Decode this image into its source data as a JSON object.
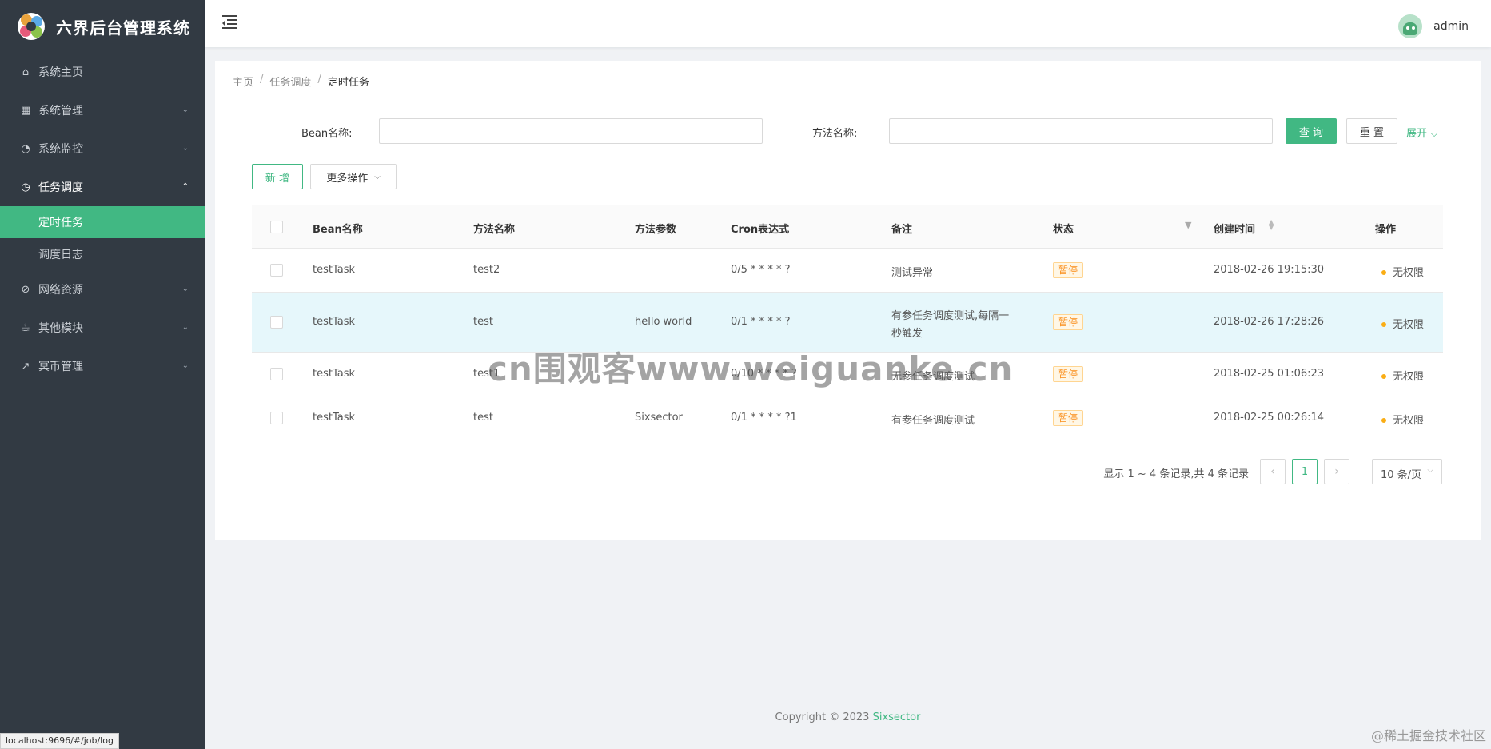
{
  "app": {
    "title": "六界后台管理系统"
  },
  "sidebar": {
    "items": [
      {
        "label": "系统主页",
        "icon": "home-icon"
      },
      {
        "label": "系统管理",
        "icon": "grid-icon"
      },
      {
        "label": "系统监控",
        "icon": "dashboard-icon"
      },
      {
        "label": "任务调度",
        "icon": "clock-icon"
      },
      {
        "label": "网络资源",
        "icon": "compass-icon"
      },
      {
        "label": "其他模块",
        "icon": "cup-icon"
      },
      {
        "label": "冥币管理",
        "icon": "trend-icon"
      }
    ],
    "submenu": [
      {
        "label": "定时任务"
      },
      {
        "label": "调度日志"
      }
    ]
  },
  "header": {
    "username": "admin"
  },
  "breadcrumb": [
    "主页",
    "任务调度",
    "定时任务"
  ],
  "search": {
    "bean_label": "Bean名称:",
    "bean_value": "",
    "method_label": "方法名称:",
    "method_value": "",
    "query_label": "查 询",
    "reset_label": "重 置",
    "expand_label": "展开"
  },
  "toolbar": {
    "add_label": "新 增",
    "more_label": "更多操作"
  },
  "table": {
    "columns": [
      "Bean名称",
      "方法名称",
      "方法参数",
      "Cron表达式",
      "备注",
      "状态",
      "创建时间",
      "操作"
    ],
    "rows": [
      {
        "bean": "testTask",
        "method": "test2",
        "params": "",
        "cron": "0/5 * * * * ?",
        "remark": "测试异常",
        "remark2": "",
        "status": "暂停",
        "created": "2018-02-26 19:15:30",
        "op": "无权限"
      },
      {
        "bean": "testTask",
        "method": "test",
        "params": "hello world",
        "cron": "0/1 * * * * ?",
        "remark": "有参任务调度测试,每隔一",
        "remark2": "秒触发",
        "status": "暂停",
        "created": "2018-02-26 17:28:26",
        "op": "无权限"
      },
      {
        "bean": "testTask",
        "method": "test1",
        "params": "",
        "cron": "0/10 * * * * ?",
        "remark": "无参任务调度测试",
        "remark2": "",
        "status": "暂停",
        "created": "2018-02-25 01:06:23",
        "op": "无权限"
      },
      {
        "bean": "testTask",
        "method": "test",
        "params": "Sixsector",
        "cron": "0/1 * * * * ?1",
        "remark": "有参任务调度测试",
        "remark2": "",
        "status": "暂停",
        "created": "2018-02-25 00:26:14",
        "op": "无权限"
      }
    ]
  },
  "pagination": {
    "total_text": "显示 1 ~ 4 条记录,共 4 条记录",
    "current": "1",
    "page_size": "10 条/页"
  },
  "footer": {
    "copyright": "Copyright © 2023 ",
    "brand": "Sixsector"
  },
  "status_url": "localhost:9696/#/job/log",
  "watermark": "cn围观客www.weiguanke.cn",
  "corner_mark": "@稀土掘金技术社区",
  "colors": {
    "accent": "#41b883",
    "sidebar_bg": "#323a43",
    "tag_warning": "#fa8c16"
  }
}
